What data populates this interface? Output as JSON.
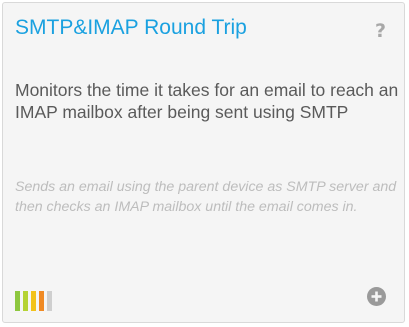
{
  "card": {
    "title": "SMTP&IMAP Round Trip",
    "help_glyph": "?",
    "description": "Monitors the time it takes for an email to reach an IMAP mailbox after being sent using SMTP",
    "details": "Sends an email using the parent device as SMTP server and then checks an IMAP mailbox until the email comes in.",
    "performance_icon": "performance-bars-icon",
    "add_icon": "plus-circle-icon"
  },
  "colors": {
    "title": "#1aa1e0",
    "performance_bars": [
      "#8dc73f",
      "#b5d334",
      "#f2c21a",
      "#f08a24",
      "#cfcfcf"
    ]
  }
}
